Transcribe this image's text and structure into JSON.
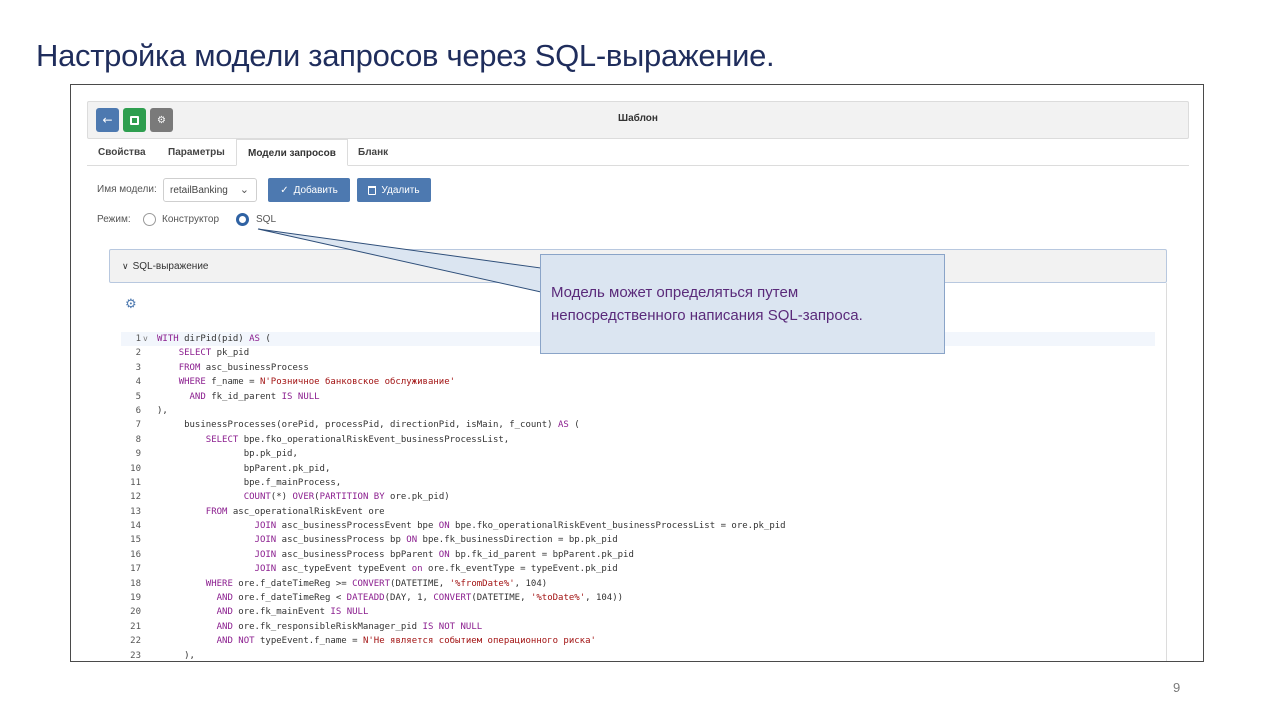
{
  "slide": {
    "title": "Настройка модели запросов через SQL-выражение.",
    "page_number": "9"
  },
  "toolbar": {
    "title": "Шаблон",
    "back_icon": "arrow-left-icon",
    "save_icon": "save-icon",
    "settings_icon": "gears-icon"
  },
  "tabs": [
    {
      "label": "Свойства"
    },
    {
      "label": "Параметры"
    },
    {
      "label": "Модели запросов",
      "active": true
    },
    {
      "label": "Бланк"
    }
  ],
  "model": {
    "name_label": "Имя модели:",
    "selected": "retailBanking",
    "add_label": "Добавить",
    "delete_label": "Удалить",
    "mode_label": "Режим:",
    "mode_constructor": "Конструктор",
    "mode_sql": "SQL",
    "selected_mode": "SQL"
  },
  "panel": {
    "title": "SQL-выражение"
  },
  "code": [
    {
      "n": "1",
      "fold": "v",
      "t": "WITH dirPid(pid) AS ("
    },
    {
      "n": "2",
      "t": "    SELECT pk_pid"
    },
    {
      "n": "3",
      "t": "    FROM asc_businessProcess"
    },
    {
      "n": "4",
      "t": "    WHERE f_name = N'Розничное банковское обслуживание'"
    },
    {
      "n": "5",
      "t": "      AND fk_id_parent IS NULL"
    },
    {
      "n": "6",
      "t": "),"
    },
    {
      "n": "7",
      "t": "     businessProcesses(orePid, processPid, directionPid, isMain, f_count) AS ("
    },
    {
      "n": "8",
      "t": "         SELECT bpe.fko_operationalRiskEvent_businessProcessList,"
    },
    {
      "n": "9",
      "t": "                bp.pk_pid,"
    },
    {
      "n": "10",
      "t": "                bpParent.pk_pid,"
    },
    {
      "n": "11",
      "t": "                bpe.f_mainProcess,"
    },
    {
      "n": "12",
      "t": "                COUNT(*) OVER(PARTITION BY ore.pk_pid)"
    },
    {
      "n": "13",
      "t": "         FROM asc_operationalRiskEvent ore"
    },
    {
      "n": "14",
      "t": "                  JOIN asc_businessProcessEvent bpe ON bpe.fko_operationalRiskEvent_businessProcessList = ore.pk_pid"
    },
    {
      "n": "15",
      "t": "                  JOIN asc_businessProcess bp ON bpe.fk_businessDirection = bp.pk_pid"
    },
    {
      "n": "16",
      "t": "                  JOIN asc_businessProcess bpParent ON bp.fk_id_parent = bpParent.pk_pid"
    },
    {
      "n": "17",
      "t": "                  JOIN asc_typeEvent typeEvent on ore.fk_eventType = typeEvent.pk_pid"
    },
    {
      "n": "18",
      "t": "         WHERE ore.f_dateTimeReg >= CONVERT(DATETIME, '%fromDate%', 104)"
    },
    {
      "n": "19",
      "t": "           AND ore.f_dateTimeReg < DATEADD(DAY, 1, CONVERT(DATETIME, '%toDate%', 104))"
    },
    {
      "n": "20",
      "t": "           AND ore.fk_mainEvent IS NULL"
    },
    {
      "n": "21",
      "t": "           AND ore.fk_responsibleRiskManager_pid IS NOT NULL"
    },
    {
      "n": "22",
      "t": "           AND NOT typeEvent.f_name = N'Не является событием операционного риска'"
    },
    {
      "n": "23",
      "t": "     ),"
    }
  ],
  "callout": {
    "line1": "Модель может определяться путем",
    "line2": "непосредственного написания SQL-запроса."
  }
}
